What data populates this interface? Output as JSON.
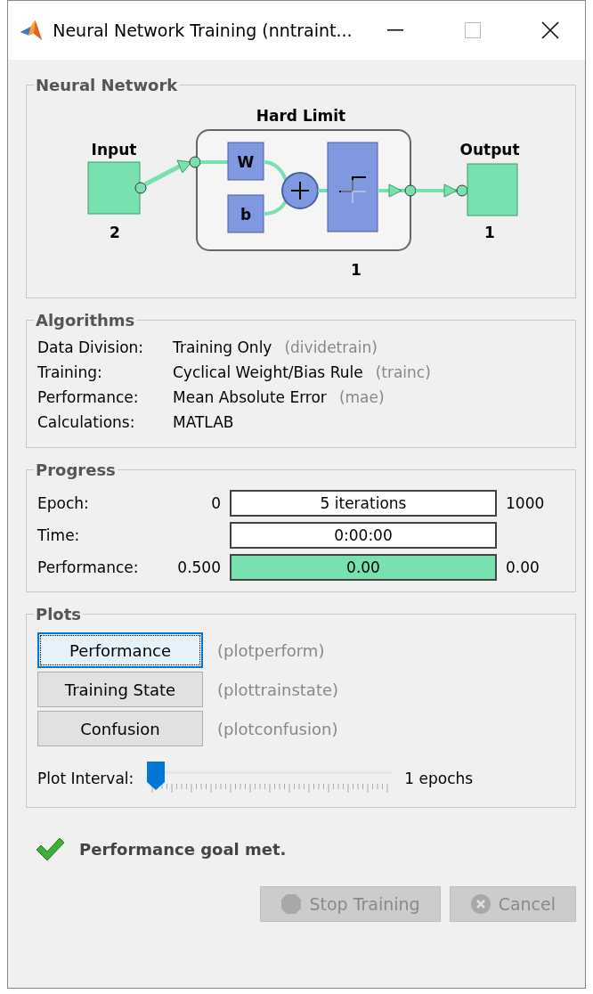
{
  "window": {
    "title": "Neural Network Training (nntraint..."
  },
  "network": {
    "title": "Neural Network",
    "layer_name": "Hard Limit",
    "input_label": "Input",
    "input_size": "2",
    "weight_label": "W",
    "bias_label": "b",
    "layer_size": "1",
    "output_label": "Output",
    "output_size": "1"
  },
  "algorithms": {
    "title": "Algorithms",
    "rows": [
      {
        "label": "Data Division:",
        "value": "Training Only",
        "function": "(dividetrain)"
      },
      {
        "label": "Training:",
        "value": "Cyclical Weight/Bias Rule",
        "function": "(trainc)"
      },
      {
        "label": "Performance:",
        "value": "Mean Absolute Error",
        "function": "(mae)"
      },
      {
        "label": "Calculations:",
        "value": "MATLAB"
      }
    ]
  },
  "progress": {
    "title": "Progress",
    "rows": [
      {
        "label": "Epoch:",
        "start": "0",
        "reading": "5 iterations",
        "end": "1000"
      },
      {
        "label": "Time:",
        "reading": "0:00:00"
      },
      {
        "label": "Performance:",
        "start": "0.500",
        "reading": "0.00",
        "level": 1,
        "end": "0.00"
      }
    ]
  },
  "plots": {
    "title": "Plots",
    "buttons": [
      {
        "label": "Performance",
        "function": "(plotperform)",
        "focused": true
      },
      {
        "label": "Training State",
        "function": "(plottrainstate)",
        "focused": false
      },
      {
        "label": "Confusion",
        "function": "(plotconfusion)",
        "focused": false
      }
    ],
    "interval": {
      "label": "Plot Interval:",
      "level": 0,
      "reading": "1 epochs"
    }
  },
  "status": {
    "message": "Performance goal met."
  },
  "actions": [
    {
      "label": "Stop Training",
      "kind": "stop",
      "disabled": true
    },
    {
      "label": "Cancel",
      "kind": "cancel",
      "disabled": true
    }
  ]
}
